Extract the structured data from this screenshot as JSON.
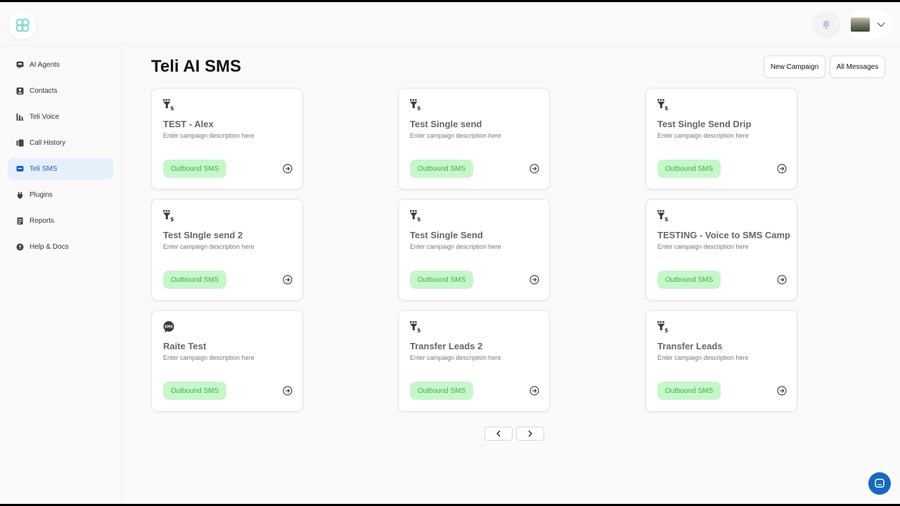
{
  "app": {
    "title": "Teli AI SMS"
  },
  "sidebar": {
    "items": [
      {
        "label": "AI Agents",
        "icon": "message-bot-icon"
      },
      {
        "label": "Contacts",
        "icon": "contacts-icon"
      },
      {
        "label": "Teli Voice",
        "icon": "voice-icon"
      },
      {
        "label": "Call History",
        "icon": "call-history-icon"
      },
      {
        "label": "Teli SMS",
        "icon": "sms-icon",
        "active": true
      },
      {
        "label": "Plugins",
        "icon": "plugin-icon"
      },
      {
        "label": "Reports",
        "icon": "reports-icon"
      },
      {
        "label": "Help & Docs",
        "icon": "help-icon"
      }
    ]
  },
  "header": {
    "new_campaign": "New Campaign",
    "all_messages": "All Messages"
  },
  "campaigns": [
    {
      "title": "TEST - Alex",
      "desc": "Enter campaign description here",
      "badge": "Outbound SMS",
      "icon": "funnel-dollar-icon"
    },
    {
      "title": "Test Single send",
      "desc": "Enter campaign description here",
      "badge": "Outbound SMS",
      "icon": "funnel-dollar-icon"
    },
    {
      "title": "Test Single Send Drip",
      "desc": "Enter campaign description here",
      "badge": "Outbound SMS",
      "icon": "funnel-dollar-icon"
    },
    {
      "title": "Test SIngle send 2",
      "desc": "Enter campaign description here",
      "badge": "Outbound SMS",
      "icon": "funnel-dollar-icon"
    },
    {
      "title": "Test Single Send",
      "desc": "Enter campaign description here",
      "badge": "Outbound SMS",
      "icon": "funnel-dollar-icon"
    },
    {
      "title": "TESTING - Voice to SMS Camp",
      "desc": "Enter campaign description here",
      "badge": "Outbound SMS",
      "icon": "funnel-dollar-icon"
    },
    {
      "title": "Raite Test",
      "desc": "Enter campaign description here",
      "badge": "Outbound SMS",
      "icon": "sms-bubble-icon",
      "icon_text": "SMS"
    },
    {
      "title": "Transfer Leads 2",
      "desc": "Enter campaign description here",
      "badge": "Outbound SMS",
      "icon": "funnel-dollar-icon"
    },
    {
      "title": "Transfer Leads",
      "desc": "Enter campaign description here",
      "badge": "Outbound SMS",
      "icon": "funnel-dollar-icon"
    }
  ],
  "colors": {
    "accent": "#1b5fb8",
    "active_bg": "#e6f0fb",
    "badge_bg": "#c6f7c9",
    "badge_text": "#3fae55",
    "fab": "#1669c2"
  }
}
